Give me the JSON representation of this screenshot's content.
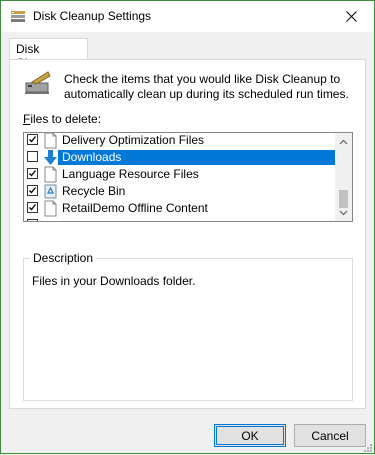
{
  "window": {
    "title": "Disk Cleanup Settings"
  },
  "tabs": [
    {
      "label": "Disk Cleanup"
    }
  ],
  "header": {
    "text": "Check the items that you would like Disk Cleanup to automatically clean up during its scheduled run times."
  },
  "files": {
    "label_prefix": "F",
    "label_rest": "iles to delete:",
    "items": [
      {
        "label": "Delivery Optimization Files",
        "checked": true,
        "icon": "file-icon",
        "selected": false
      },
      {
        "label": "Downloads",
        "checked": false,
        "icon": "download-arrow-icon",
        "selected": true
      },
      {
        "label": "Language Resource Files",
        "checked": true,
        "icon": "file-icon",
        "selected": false
      },
      {
        "label": "Recycle Bin",
        "checked": true,
        "icon": "recycle-bin-icon",
        "selected": false
      },
      {
        "label": "RetailDemo Offline Content",
        "checked": true,
        "icon": "file-icon",
        "selected": false
      }
    ]
  },
  "description": {
    "legend": "Description",
    "text": "Files in your Downloads folder."
  },
  "buttons": {
    "ok": "OK",
    "cancel": "Cancel"
  },
  "colors": {
    "selection": "#0078d7",
    "accent_border": "#3c8d3c"
  }
}
